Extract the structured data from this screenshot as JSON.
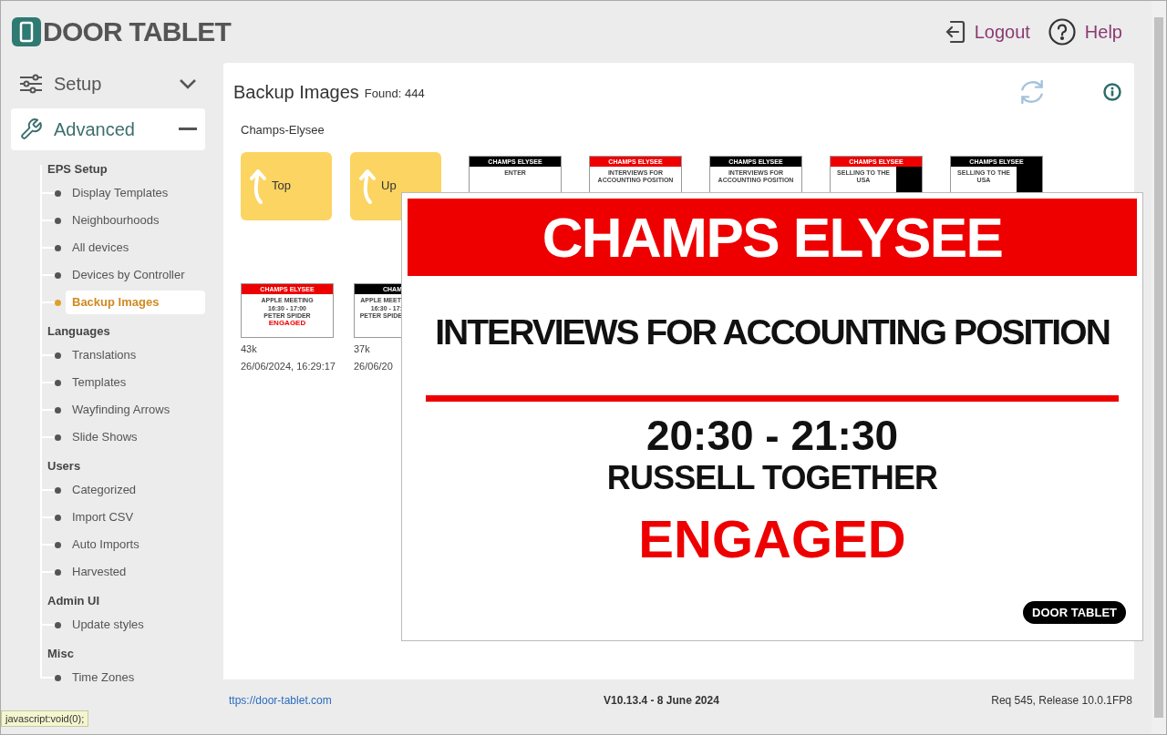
{
  "header": {
    "logo": "DOOR TABLET",
    "links": [
      {
        "kind": "logout",
        "label": "Logout"
      },
      {
        "kind": "help",
        "label": "Help"
      }
    ]
  },
  "sidebar": {
    "sections": [
      {
        "kind": "setup",
        "label": "Setup",
        "expanded": false
      },
      {
        "kind": "advanced",
        "label": "Advanced",
        "expanded": true
      }
    ],
    "groups": [
      {
        "title": "EPS Setup",
        "items": [
          {
            "label": "Display Templates",
            "selected": false
          },
          {
            "label": "Neighbourhoods",
            "selected": false
          },
          {
            "label": "All devices",
            "selected": false
          },
          {
            "label": "Devices by Controller",
            "selected": false
          },
          {
            "label": "Backup Images",
            "selected": true
          }
        ]
      },
      {
        "title": "Languages",
        "items": [
          {
            "label": "Translations",
            "selected": false
          },
          {
            "label": "Templates",
            "selected": false
          },
          {
            "label": "Wayfinding Arrows",
            "selected": false
          },
          {
            "label": "Slide Shows",
            "selected": false
          }
        ]
      },
      {
        "title": "Users",
        "items": [
          {
            "label": "Categorized",
            "selected": false
          },
          {
            "label": "Import CSV",
            "selected": false
          },
          {
            "label": "Auto Imports",
            "selected": false
          },
          {
            "label": "Harvested",
            "selected": false
          }
        ]
      },
      {
        "title": "Admin UI",
        "items": [
          {
            "label": "Update styles",
            "selected": false
          }
        ]
      },
      {
        "title": "Misc",
        "items": [
          {
            "label": "Time Zones",
            "selected": false
          }
        ]
      }
    ]
  },
  "main": {
    "title": "Backup Images",
    "found": "Found: 444",
    "path": "Champs-Elysee",
    "folders": [
      {
        "label": "Top"
      },
      {
        "label": "Up"
      }
    ],
    "thumbs_top": [
      {
        "header": "CHAMPS ELYSEE",
        "color": "#000000",
        "line": "ENTER",
        "side_panel": false
      },
      {
        "header": "CHAMPS ELYSEE",
        "color": "#ee0000",
        "line": "INTERVIEWS FOR ACCOUNTING POSITION",
        "side_panel": false
      },
      {
        "header": "CHAMPS ELYSEE",
        "color": "#000000",
        "line": "INTERVIEWS FOR ACCOUNTING POSITION",
        "side_panel": false
      },
      {
        "header": "CHAMPS ELYSEE",
        "color": "#ee0000",
        "line": "SELLING TO THE USA",
        "side_panel": true
      },
      {
        "header": "CHAMPS ELYSEE",
        "color": "#000000",
        "line": "SELLING TO THE USA",
        "side_panel": true
      }
    ],
    "thumbs_bottom": [
      {
        "header": "CHAMPS ELYSEE",
        "color": "#ee0000",
        "line": "APPLE MEETING",
        "time": "16:30 - 17:00",
        "person": "PETER SPIDER",
        "status": "ENGAGED",
        "size": "43k",
        "date": "26/06/2024, 16:29:17"
      },
      {
        "header": "CHAM",
        "color": "#000000",
        "line": "APPLE MEET",
        "time": "16:30 - 17:",
        "person": "PETER SPIDE",
        "size": "37k",
        "date": "26/06/20"
      }
    ],
    "preview": {
      "header": "CHAMPS ELYSEE",
      "title": "INTERVIEWS FOR ACCOUNTING POSITION",
      "time": "20:30 - 21:30",
      "person": "RUSSELL TOGETHER",
      "status": "ENGAGED",
      "badge": "DOOR TABLET"
    }
  },
  "footer": {
    "link": "ttps://door-tablet.com",
    "version": "V10.13.4 - 8 June 2024",
    "release": "Req 545, Release 10.0.1FP8"
  },
  "status_tip": "javascript:void(0);"
}
